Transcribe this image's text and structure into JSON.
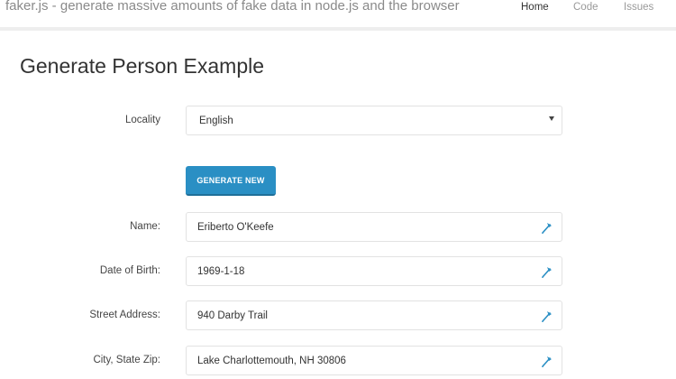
{
  "navbar": {
    "brand": "faker.js - generate massive amounts of fake data in node.js and the browser",
    "links": [
      {
        "label": "Home",
        "active": true
      },
      {
        "label": "Code",
        "active": false
      },
      {
        "label": "Issues",
        "active": false
      }
    ]
  },
  "main": {
    "title": "Generate Person Example",
    "locality": {
      "label": "Locality",
      "selected": "English"
    },
    "generate_button": "GENERATE NEW",
    "fields": [
      {
        "label": "Name:",
        "value": "Eriberto O'Keefe"
      },
      {
        "label": "Date of Birth:",
        "value": "1969-1-18"
      },
      {
        "label": "Street Address:",
        "value": "940 Darby Trail"
      },
      {
        "label": "City, State Zip:",
        "value": "Lake Charlottemouth, NH 30806"
      }
    ]
  },
  "colors": {
    "accent": "#2a8fc4",
    "icon": "#2a8fc4"
  },
  "icons": {
    "field_action": "copy-icon"
  }
}
